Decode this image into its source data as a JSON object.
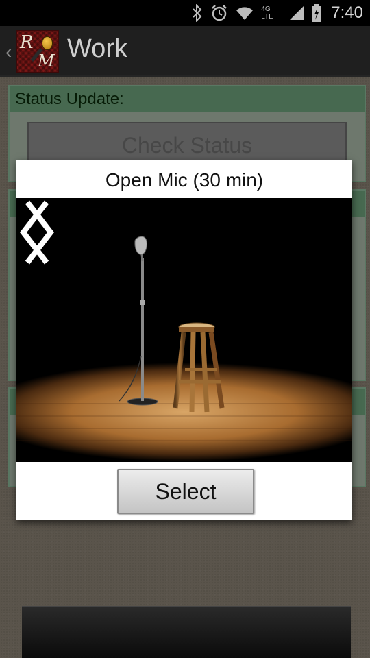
{
  "status_bar": {
    "time": "7:40",
    "network": "4G LTE",
    "icons": [
      "bluetooth-icon",
      "alarm-icon",
      "wifi-icon",
      "signal-icon",
      "battery-icon"
    ]
  },
  "action_bar": {
    "title": "Work",
    "logo_letters": [
      "R",
      "M"
    ]
  },
  "background": {
    "panel_header": "Status Update:",
    "check_button": "Check Status"
  },
  "dialog": {
    "title": "Open Mic (30 min)",
    "image_name": "open-mic-stage",
    "prev_icon": "chevron-left-icon",
    "next_icon": "chevron-right-icon",
    "select_label": "Select"
  },
  "colors": {
    "panel_header": "#6ea27c",
    "action_bar": "#1f1f1f",
    "dialog_bg": "#ffffff",
    "stage_wood": "#b7803c"
  }
}
